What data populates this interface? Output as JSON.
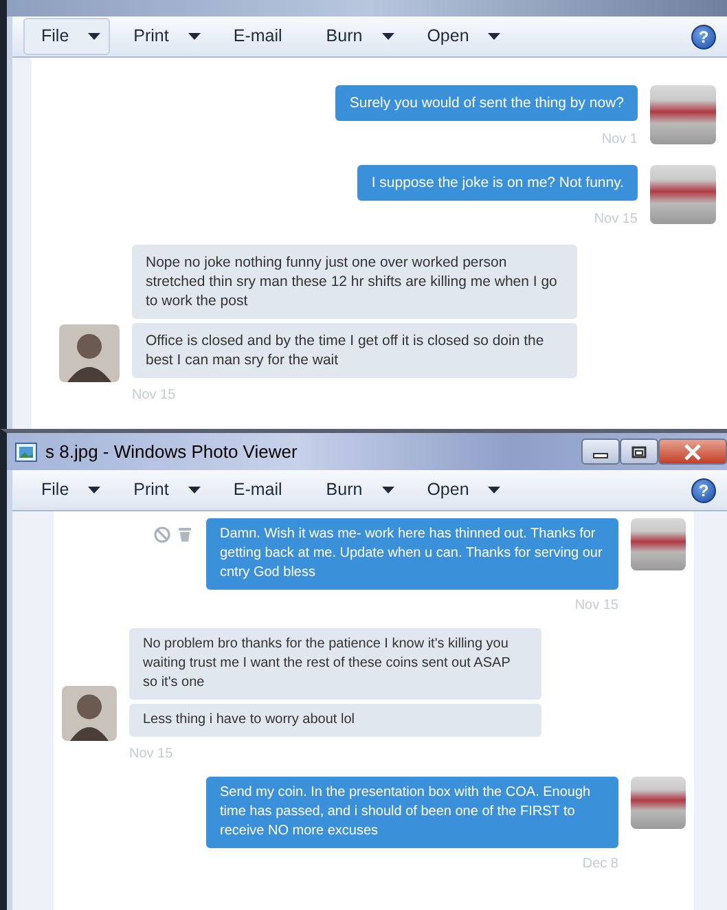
{
  "windows": [
    {
      "toolbar": [
        {
          "label": "File",
          "dropdown": true,
          "hovered": true
        },
        {
          "label": "Print",
          "dropdown": true,
          "hovered": false
        },
        {
          "label": "E-mail",
          "dropdown": false,
          "hovered": false
        },
        {
          "label": "Burn",
          "dropdown": true,
          "hovered": false
        },
        {
          "label": "Open",
          "dropdown": true,
          "hovered": false
        }
      ],
      "help": "?",
      "conversation": [
        {
          "kind": "out",
          "actions": false,
          "messages": [
            "Surely you would of sent the thing by now?"
          ],
          "date": "Nov 1"
        },
        {
          "kind": "out",
          "actions": false,
          "messages": [
            "I suppose the joke is on me? Not funny."
          ],
          "date": "Nov 15"
        },
        {
          "kind": "in",
          "actions": false,
          "messages": [
            "Nope no joke nothing funny just one over worked person stretched thin sry man these 12 hr shifts are killing me when I go to work the post",
            "Office is closed and by the time I get off it is closed so doin the best I can man sry for the wait"
          ],
          "date": "Nov 15"
        }
      ]
    },
    {
      "title": "s 8.jpg - Windows Photo Viewer",
      "toolbar": [
        {
          "label": "File",
          "dropdown": true,
          "hovered": false
        },
        {
          "label": "Print",
          "dropdown": true,
          "hovered": false
        },
        {
          "label": "E-mail",
          "dropdown": false,
          "hovered": false
        },
        {
          "label": "Burn",
          "dropdown": true,
          "hovered": false
        },
        {
          "label": "Open",
          "dropdown": true,
          "hovered": false
        }
      ],
      "help": "?",
      "conversation": [
        {
          "kind": "out",
          "actions": true,
          "messages": [
            "Damn. Wish it was me- work here has thinned out. Thanks for getting back at me. Update when u can. Thanks for serving our cntry God bless"
          ],
          "date": "Nov 15"
        },
        {
          "kind": "in",
          "actions": false,
          "messages": [
            "No problem bro thanks for the patience I know it's killing you waiting trust me I want the rest of these coins sent out ASAP so it's one",
            "Less thing i have to worry about lol"
          ],
          "date": "Nov 15"
        },
        {
          "kind": "out",
          "actions": false,
          "messages": [
            "Send my coin. In the presentation box with the COA. Enough time has passed, and i should of been one of the FIRST to receive NO more excuses"
          ],
          "date": "Dec 8"
        }
      ]
    }
  ]
}
